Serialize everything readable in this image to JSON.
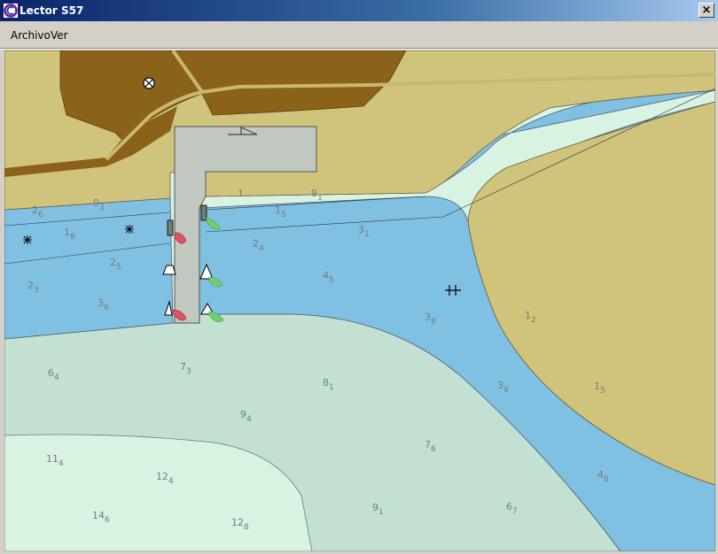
{
  "window": {
    "title": "Lector S57",
    "close_glyph": "×"
  },
  "menu": {
    "items": [
      "Archivo",
      "Ver"
    ]
  },
  "colors": {
    "land_dark": "#8b6219",
    "land_light": "#d0c47c",
    "water_shallow": "#80c0e2",
    "water_mid": "#c2e1d3",
    "water_deep": "#d9f3e3",
    "jetty": "#c0c8c0"
  },
  "map": {
    "icons": [
      "wreck-icon",
      "obstruction-icon",
      "obstruction-icon",
      "beacon-icon",
      "buoy-icon",
      "buoy-icon",
      "light-red-icon",
      "light-green-icon",
      "light-red-icon",
      "light-green-icon"
    ],
    "soundings": [
      {
        "m": "2",
        "d": "6"
      },
      {
        "m": "9",
        "d": "3"
      },
      {
        "m": "1",
        "d": "8"
      },
      {
        "m": "2",
        "d": "5"
      },
      {
        "m": "2",
        "d": "3"
      },
      {
        "m": "3",
        "d": "6"
      },
      {
        "m": "1",
        "d": ""
      },
      {
        "m": "9",
        "d": "1"
      },
      {
        "m": "1",
        "d": "5"
      },
      {
        "m": "2",
        "d": "4"
      },
      {
        "m": "3",
        "d": "1"
      },
      {
        "m": "4",
        "d": "5"
      },
      {
        "m": "3",
        "d": "8"
      },
      {
        "m": "1",
        "d": "2"
      },
      {
        "m": "3",
        "d": "9"
      },
      {
        "m": "1",
        "d": "5"
      },
      {
        "m": "6",
        "d": "4"
      },
      {
        "m": "7",
        "d": "3"
      },
      {
        "m": "8",
        "d": "1"
      },
      {
        "m": "9",
        "d": "4"
      },
      {
        "m": "7",
        "d": "6"
      },
      {
        "m": "11",
        "d": "4"
      },
      {
        "m": "12",
        "d": "4"
      },
      {
        "m": "14",
        "d": "6"
      },
      {
        "m": "12",
        "d": "8"
      },
      {
        "m": "9",
        "d": "1"
      },
      {
        "m": "6",
        "d": "7"
      },
      {
        "m": "4",
        "d": "6"
      }
    ]
  }
}
